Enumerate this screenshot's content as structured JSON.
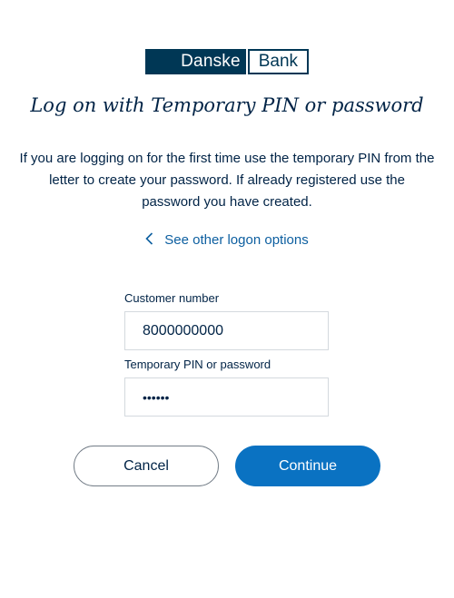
{
  "logo": {
    "left_text": "Danske",
    "right_text": "Bank"
  },
  "title": "Log on with Temporary PIN or password",
  "intro": "If you are logging on for the first time use the temporary PIN from the letter to create your password. If already registered use the password you have created.",
  "other_options": {
    "label": "See other logon options",
    "icon": "chevron-left-icon"
  },
  "form": {
    "customer_label": "Customer number",
    "customer_value": "8000000000",
    "pin_label": "Temporary PIN or password",
    "pin_value": "••••••"
  },
  "buttons": {
    "cancel": "Cancel",
    "continue": "Continue"
  },
  "colors": {
    "brand_dark": "#003755",
    "text": "#002346",
    "link": "#0d5fa0",
    "primary_button": "#0a72c2"
  }
}
